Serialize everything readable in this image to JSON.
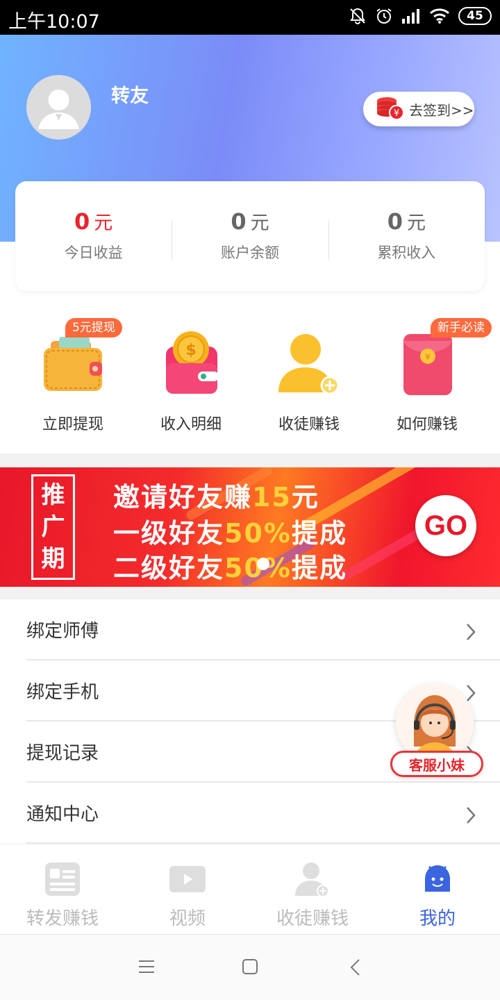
{
  "status_bar": {
    "time": "上午10:07",
    "battery": "45"
  },
  "profile": {
    "username": "转友",
    "signin_label": "去签到>>"
  },
  "stats": [
    {
      "value": "0",
      "unit": "元",
      "label": "今日收益"
    },
    {
      "value": "0",
      "unit": "元",
      "label": "账户余额"
    },
    {
      "value": "0",
      "unit": "元",
      "label": "累积收入"
    }
  ],
  "features": [
    {
      "label": "立即提现",
      "tag": "5元提现",
      "icon": "wallet-icon"
    },
    {
      "label": "收入明细",
      "tag": "",
      "icon": "coin-purse-icon"
    },
    {
      "label": "收徒赚钱",
      "tag": "",
      "icon": "add-user-icon"
    },
    {
      "label": "如何赚钱",
      "tag": "新手必读",
      "icon": "red-envelope-icon"
    }
  ],
  "banner": {
    "promo": [
      "推",
      "广",
      "期"
    ],
    "line1_a": "邀请好友赚",
    "line1_b": "15",
    "line1_c": "元",
    "line2_a": "一级好友",
    "line2_b": "50%",
    "line2_c": "提成",
    "line3_a": "二级好友",
    "line3_b": "50%",
    "line3_c": "提成",
    "go_label": "GO"
  },
  "menu": [
    {
      "label": "绑定师傅"
    },
    {
      "label": "绑定手机"
    },
    {
      "label": "提现记录"
    },
    {
      "label": "通知中心"
    }
  ],
  "service": {
    "label": "客服小妹"
  },
  "tabs": [
    {
      "label": "转发赚钱",
      "icon": "news-icon",
      "active": false
    },
    {
      "label": "视频",
      "icon": "video-icon",
      "active": false
    },
    {
      "label": "收徒赚钱",
      "icon": "add-user-icon",
      "active": false
    },
    {
      "label": "我的",
      "icon": "smiley-icon",
      "active": true
    }
  ],
  "colors": {
    "accent": "#3b64e0",
    "red": "#e8242c",
    "tag": "#ff6a3d"
  }
}
